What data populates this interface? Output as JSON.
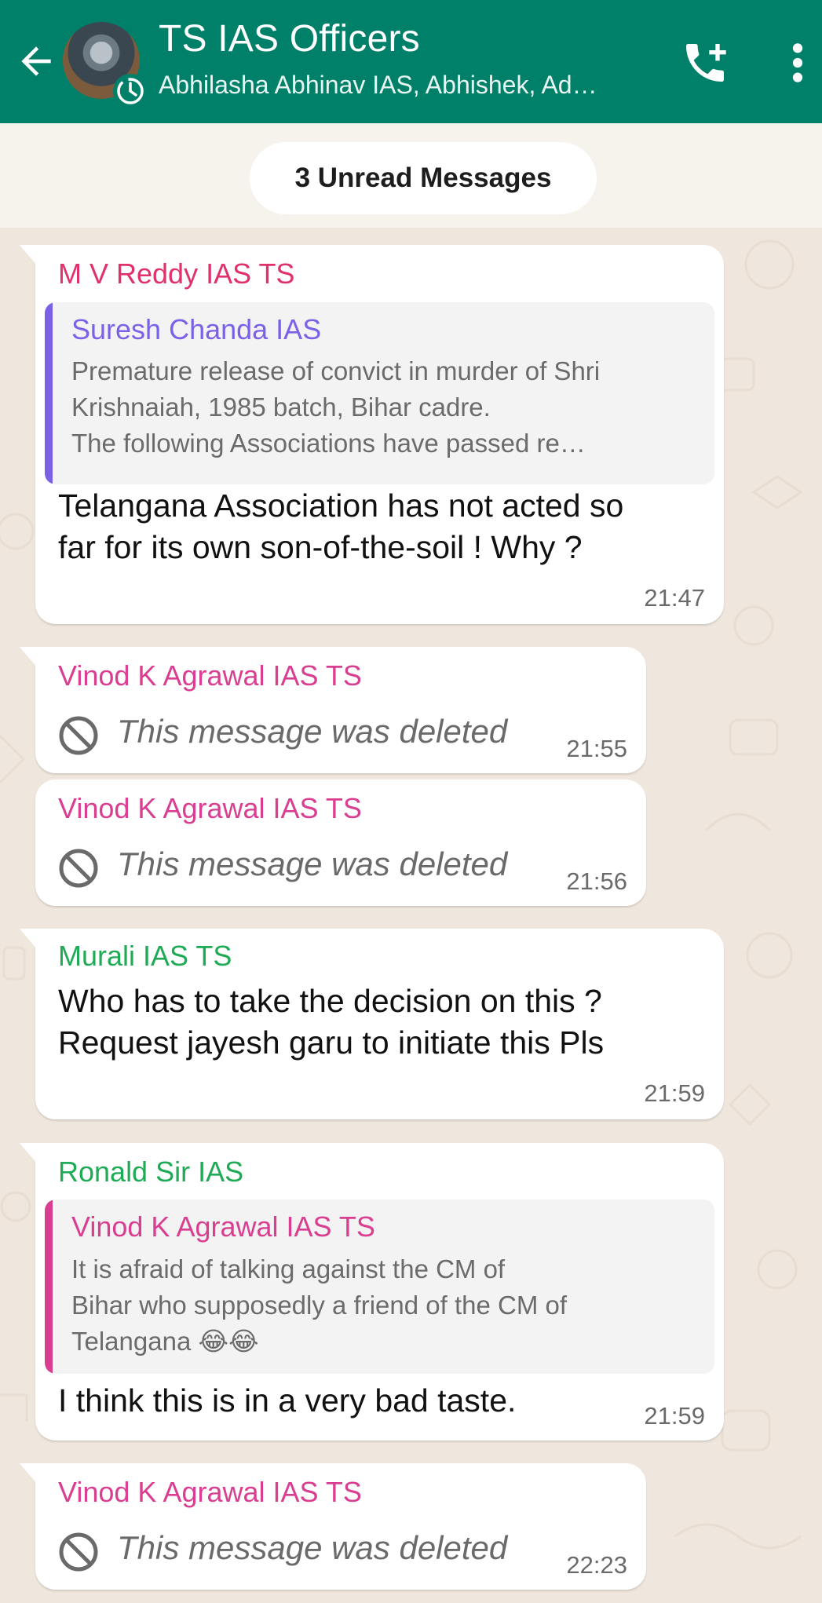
{
  "header": {
    "title": "TS IAS Officers",
    "subtitle": "Abhilasha Abhinav IAS, Abhishek, Ad…",
    "back_icon": "arrow-left-icon",
    "call_icon": "add-call-icon",
    "menu_icon": "more-vertical-icon",
    "color": "#008069"
  },
  "unread": {
    "label": "3 Unread Messages"
  },
  "messages": [
    {
      "sender": "M V Reddy IAS TS",
      "sender_color": "#e0306e",
      "quote": {
        "sender": "Suresh Chanda IAS",
        "sender_color": "#7b61e8",
        "text": "Premature release of convict in murder of Shri\nKrishnaiah, 1985 batch, Bihar cadre.\nThe  following  Associations have passed re…"
      },
      "text": "Telangana Association has not acted so\nfar for its own son-of-the-soil ! Why ?",
      "time": "21:47"
    },
    {
      "sender": "Vinod K Agrawal IAS TS",
      "sender_color": "#d93e91",
      "deleted": "This message was deleted",
      "time": "21:55"
    },
    {
      "sender": "Vinod K Agrawal IAS TS",
      "sender_color": "#d93e91",
      "deleted": "This message was deleted",
      "time": "21:56"
    },
    {
      "sender": "Murali IAS TS",
      "sender_color": "#1faa55",
      "text": "Who has to take the decision on this ?\nRequest jayesh garu to initiate this Pls",
      "time": "21:59"
    },
    {
      "sender": "Ronald Sir IAS",
      "sender_color": "#1faa55",
      "quote": {
        "sender": "Vinod K Agrawal IAS TS",
        "sender_color": "#d93e91",
        "text": "It is afraid of talking against the CM of\nBihar who supposedly a friend of the CM of\nTelangana 😂😂"
      },
      "text": "I think this is in a very bad taste.",
      "time": "21:59"
    },
    {
      "sender": "Vinod K Agrawal IAS TS",
      "sender_color": "#d93e91",
      "deleted": "This message was deleted",
      "time": "22:23"
    }
  ]
}
